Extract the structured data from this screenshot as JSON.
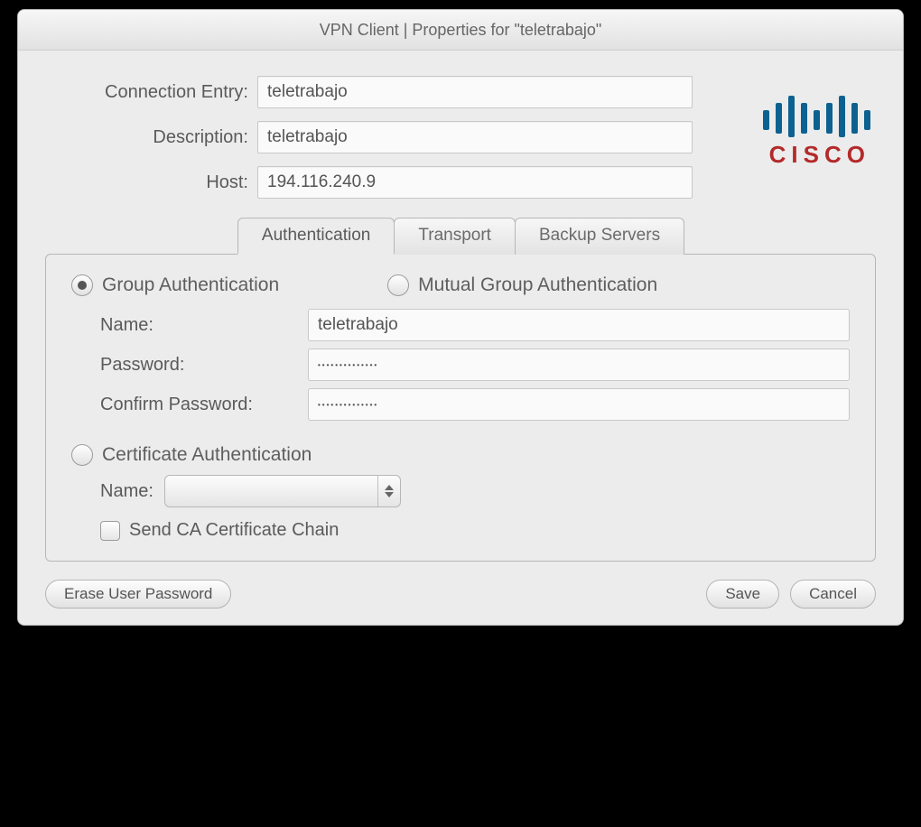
{
  "title": "VPN Client   |   Properties for \"teletrabajo\"",
  "form": {
    "connection_entry_label": "Connection Entry:",
    "connection_entry_value": "teletrabajo",
    "description_label": "Description:",
    "description_value": "teletrabajo",
    "host_label": "Host:",
    "host_value": "194.116.240.9"
  },
  "logo": {
    "brand": "CISCO"
  },
  "tabs": {
    "authentication": "Authentication",
    "transport": "Transport",
    "backup_servers": "Backup Servers"
  },
  "auth": {
    "group_label": "Group Authentication",
    "mutual_label": "Mutual Group Authentication",
    "name_label": "Name:",
    "name_value": "teletrabajo",
    "password_label": "Password:",
    "password_value": "••••••••••••••",
    "confirm_label": "Confirm Password:",
    "confirm_value": "••••••••••••••",
    "cert_label": "Certificate Authentication",
    "cert_name_label": "Name:",
    "cert_name_value": "",
    "send_ca_label": "Send CA Certificate Chain"
  },
  "buttons": {
    "erase": "Erase User Password",
    "save": "Save",
    "cancel": "Cancel"
  }
}
